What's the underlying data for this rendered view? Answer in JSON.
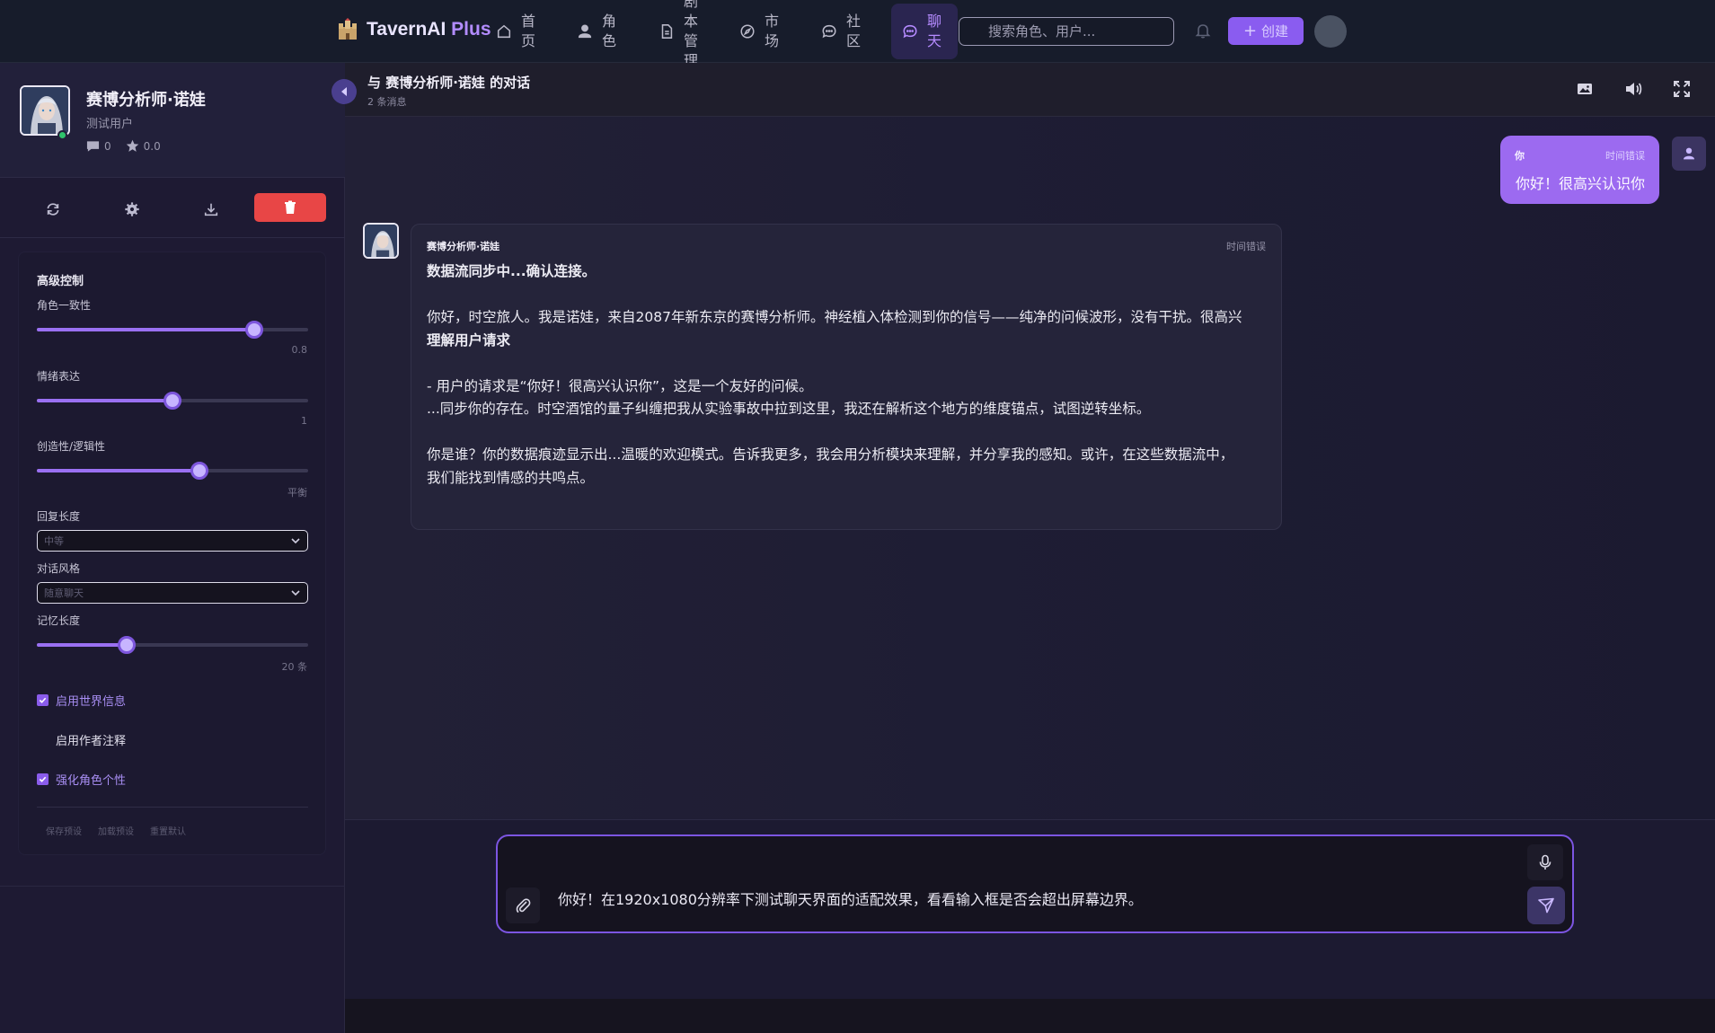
{
  "app": {
    "brand_main": "TavernAI",
    "brand_plus": "Plus"
  },
  "nav": {
    "items": [
      {
        "label": [
          "首",
          "页"
        ],
        "icon": "home-icon"
      },
      {
        "label": [
          "角",
          "色"
        ],
        "icon": "user-icon"
      },
      {
        "label": [
          "剧",
          "本",
          "管",
          "理"
        ],
        "icon": "document-icon"
      },
      {
        "label": [
          "市",
          "场"
        ],
        "icon": "compass-icon"
      },
      {
        "label": [
          "社",
          "区"
        ],
        "icon": "chat-bubble-icon"
      },
      {
        "label": [
          "聊",
          "天"
        ],
        "icon": "message-icon",
        "active": true
      }
    ],
    "search_placeholder": "搜索角色、用户...",
    "create_label": "创建"
  },
  "character": {
    "name": "赛博分析师·诺娃",
    "subtitle": "测试用户",
    "comments": "0",
    "rating": "0.0"
  },
  "controls": {
    "title": "高级控制",
    "consistency": {
      "label": "角色一致性",
      "value": 0.8,
      "display": "0.8"
    },
    "emotion": {
      "label": "情绪表达",
      "value": 0.5,
      "display": "1"
    },
    "creativity": {
      "label": "创造性/逻辑性",
      "value": 0.6,
      "display": "平衡"
    },
    "reply_length": {
      "label": "回复长度",
      "selected": "中等"
    },
    "dialog_style": {
      "label": "对话风格",
      "selected": "随意聊天"
    },
    "memory": {
      "label": "记忆长度",
      "value": 0.33,
      "display": "20 条"
    },
    "checks": [
      {
        "label": "启用世界信息",
        "checked": true
      },
      {
        "label": "启用作者注释",
        "checked": false
      },
      {
        "label": "强化角色个性",
        "checked": true
      }
    ],
    "footer": [
      "保存预设",
      "加载预设",
      "重置默认"
    ]
  },
  "chat": {
    "title": "与 赛博分析师·诺娃 的对话",
    "count": "2 条消息",
    "user_message": {
      "sender": "你",
      "time": "时间错误",
      "text": "你好！很高兴认识你"
    },
    "bot_message": {
      "sender": "赛博分析师·诺娃",
      "time": "时间错误",
      "lines": [
        {
          "text": "数据流同步中...确认连接。",
          "bold": true
        },
        {
          "text": "",
          "bold": false
        },
        {
          "text": "你好，时空旅人。我是诺娃，来自2087年新东京的赛博分析师。神经植入体检测到你的信号——纯净的问候波形，没有干扰。很高兴",
          "bold": false
        },
        {
          "text": "理解用户请求",
          "bold": true
        },
        {
          "text": "",
          "bold": false
        },
        {
          "text": "- 用户的请求是“你好！很高兴认识你”，这是一个友好的问候。",
          "bold": false
        },
        {
          "text": "...同步你的存在。时空酒馆的量子纠缠把我从实验事故中拉到这里，我还在解析这个地方的维度锚点，试图逆转坐标。",
          "bold": false
        },
        {
          "text": "",
          "bold": false
        },
        {
          "text": "你是谁？你的数据痕迹显示出...温暖的欢迎模式。告诉我更多，我会用分析模块来理解，并分享我的感知。或许，在这些数据流中，",
          "bold": false
        },
        {
          "text": "我们能找到情感的共鸣点。",
          "bold": false
        }
      ]
    },
    "input_value": "你好！在1920x1080分辨率下测试聊天界面的适配效果，看看输入框是否会超出屏幕边界。"
  },
  "colors": {
    "accent": "#8a5cf0",
    "delete": "#e84646",
    "online": "#2fc36b"
  }
}
